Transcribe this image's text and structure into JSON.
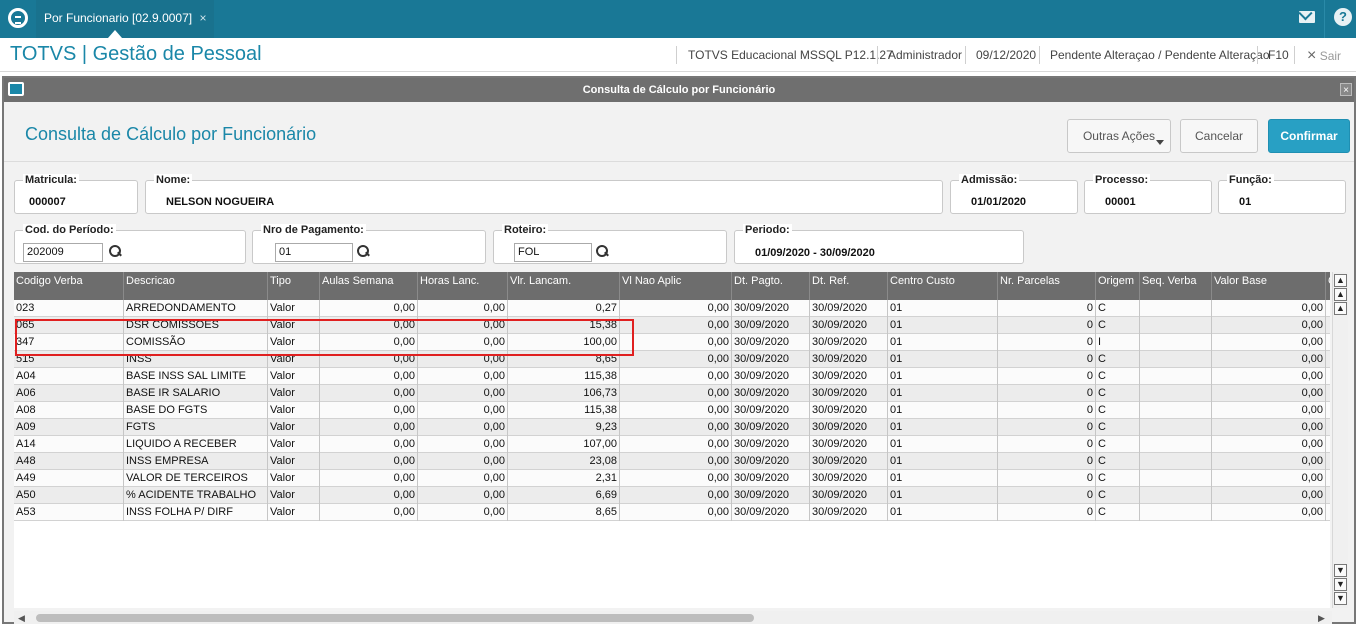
{
  "topbar": {
    "tab_label": "Por Funcionario [02.9.0007]",
    "tab_close": "×"
  },
  "apphead": {
    "title": "TOTVS | Gestão de Pessoal",
    "environment": "TOTVS Educacional MSSQL P12.1.27",
    "user": "Administrador",
    "date": "09/12/2020",
    "status": "Pendente Alteraçao / Pendente Alteraçao",
    "shortcut": "F10",
    "exit_icon": "×",
    "exit_label": "Sair"
  },
  "window": {
    "title": "Consulta de Cálculo por Funcionário",
    "close": "×",
    "form_title": "Consulta de Cálculo por Funcionário",
    "buttons": {
      "other_actions": "Outras Ações",
      "cancel": "Cancelar",
      "confirm": "Confirmar"
    }
  },
  "fields": {
    "matricula": {
      "label": "Matricula:",
      "value": "000007"
    },
    "nome": {
      "label": "Nome:",
      "value": "NELSON NOGUEIRA"
    },
    "admissao": {
      "label": "Admissão:",
      "value": "01/01/2020"
    },
    "processo": {
      "label": "Processo:",
      "value": "00001"
    },
    "funcao": {
      "label": "Função:",
      "value": "01"
    },
    "cod_periodo": {
      "label": "Cod. do Período:",
      "value": "202009"
    },
    "nro_pagamento": {
      "label": "Nro de Pagamento:",
      "value": "01"
    },
    "roteiro": {
      "label": "Roteiro:",
      "value": "FOL"
    },
    "periodo": {
      "label": "Periodo:",
      "value": "01/09/2020 - 30/09/2020"
    }
  },
  "grid": {
    "columns": [
      "Codigo Verba",
      "Descricao",
      "Tipo",
      "Aulas Semana",
      "Horas Lanc.",
      "Vlr. Lancam.",
      "Vl Nao Aplic",
      "Dt. Pagto.",
      "Dt. Ref.",
      "Centro Custo",
      "Nr. Parcelas",
      "Origem",
      "Seq. Verba",
      "Valor Base",
      "C"
    ],
    "rows": [
      [
        "023",
        "ARREDONDAMENTO",
        "Valor",
        "0,00",
        "0,00",
        "0,27",
        "0,00",
        "30/09/2020",
        "30/09/2020",
        "01",
        "0",
        "C",
        "",
        "0,00"
      ],
      [
        "065",
        "DSR COMISSOES",
        "Valor",
        "0,00",
        "0,00",
        "15,38",
        "0,00",
        "30/09/2020",
        "30/09/2020",
        "01",
        "0",
        "C",
        "",
        "0,00"
      ],
      [
        "347",
        "COMISSÃO",
        "Valor",
        "0,00",
        "0,00",
        "100,00",
        "0,00",
        "30/09/2020",
        "30/09/2020",
        "01",
        "0",
        "I",
        "",
        "0,00"
      ],
      [
        "515",
        "INSS",
        "Valor",
        "0,00",
        "0,00",
        "8,65",
        "0,00",
        "30/09/2020",
        "30/09/2020",
        "01",
        "0",
        "C",
        "",
        "0,00"
      ],
      [
        "A04",
        "BASE INSS SAL LIMITE",
        "Valor",
        "0,00",
        "0,00",
        "115,38",
        "0,00",
        "30/09/2020",
        "30/09/2020",
        "01",
        "0",
        "C",
        "",
        "0,00"
      ],
      [
        "A06",
        "BASE IR SALARIO",
        "Valor",
        "0,00",
        "0,00",
        "106,73",
        "0,00",
        "30/09/2020",
        "30/09/2020",
        "01",
        "0",
        "C",
        "",
        "0,00"
      ],
      [
        "A08",
        "BASE DO FGTS",
        "Valor",
        "0,00",
        "0,00",
        "115,38",
        "0,00",
        "30/09/2020",
        "30/09/2020",
        "01",
        "0",
        "C",
        "",
        "0,00"
      ],
      [
        "A09",
        "FGTS",
        "Valor",
        "0,00",
        "0,00",
        "9,23",
        "0,00",
        "30/09/2020",
        "30/09/2020",
        "01",
        "0",
        "C",
        "",
        "0,00"
      ],
      [
        "A14",
        "LIQUIDO A RECEBER",
        "Valor",
        "0,00",
        "0,00",
        "107,00",
        "0,00",
        "30/09/2020",
        "30/09/2020",
        "01",
        "0",
        "C",
        "",
        "0,00"
      ],
      [
        "A48",
        "INSS EMPRESA",
        "Valor",
        "0,00",
        "0,00",
        "23,08",
        "0,00",
        "30/09/2020",
        "30/09/2020",
        "01",
        "0",
        "C",
        "",
        "0,00"
      ],
      [
        "A49",
        "VALOR DE TERCEIROS",
        "Valor",
        "0,00",
        "0,00",
        "2,31",
        "0,00",
        "30/09/2020",
        "30/09/2020",
        "01",
        "0",
        "C",
        "",
        "0,00"
      ],
      [
        "A50",
        "% ACIDENTE TRABALHO",
        "Valor",
        "0,00",
        "0,00",
        "6,69",
        "0,00",
        "30/09/2020",
        "30/09/2020",
        "01",
        "0",
        "C",
        "",
        "0,00"
      ],
      [
        "A53",
        "INSS FOLHA P/ DIRF",
        "Valor",
        "0,00",
        "0,00",
        "8,65",
        "0,00",
        "30/09/2020",
        "30/09/2020",
        "01",
        "0",
        "C",
        "",
        "0,00"
      ]
    ]
  },
  "colors": {
    "brand": "#197896",
    "accent": "#1a87a8",
    "confirm": "#28a0c4",
    "highlight_border": "#e02020",
    "grid_header": "#6d6d6d"
  },
  "icons": {
    "logo": "totvs-logo-icon",
    "mail": "mail-icon",
    "help": "help-icon",
    "lookup": "magnifier-icon",
    "window": "window-icon"
  }
}
